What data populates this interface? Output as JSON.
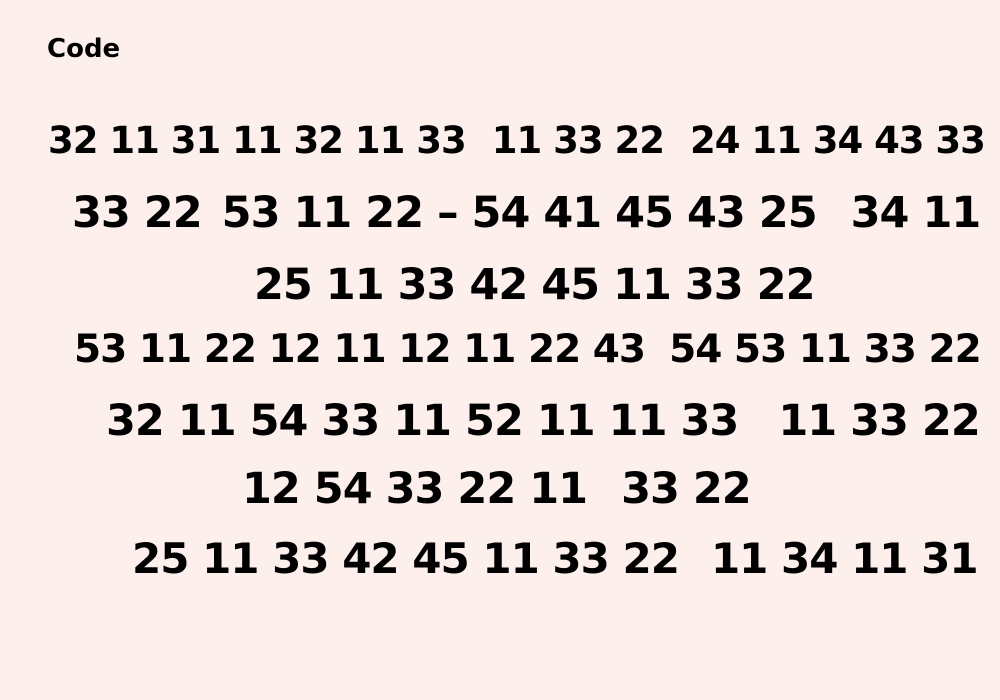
{
  "title": "Code",
  "lines": [
    [
      "32 11 31 11 32 11 33",
      "11 33 22",
      "24 11 34 43 33"
    ],
    [
      "33 22",
      "53 11 22 – 54 41 45 43 25",
      "34 11"
    ],
    [
      "25 11 33 42 45 11 33 22"
    ],
    [
      "53 11 22 12 11 12 11 22 43",
      "54 53 11 33 22"
    ],
    [
      "32 11 54 33 11 52 11 11 33",
      "11 33 22"
    ],
    [
      "12 54 33 22 11",
      "33 22"
    ],
    [
      "25 11 33 42 45 11 33 22",
      "11 34 11 31"
    ]
  ]
}
